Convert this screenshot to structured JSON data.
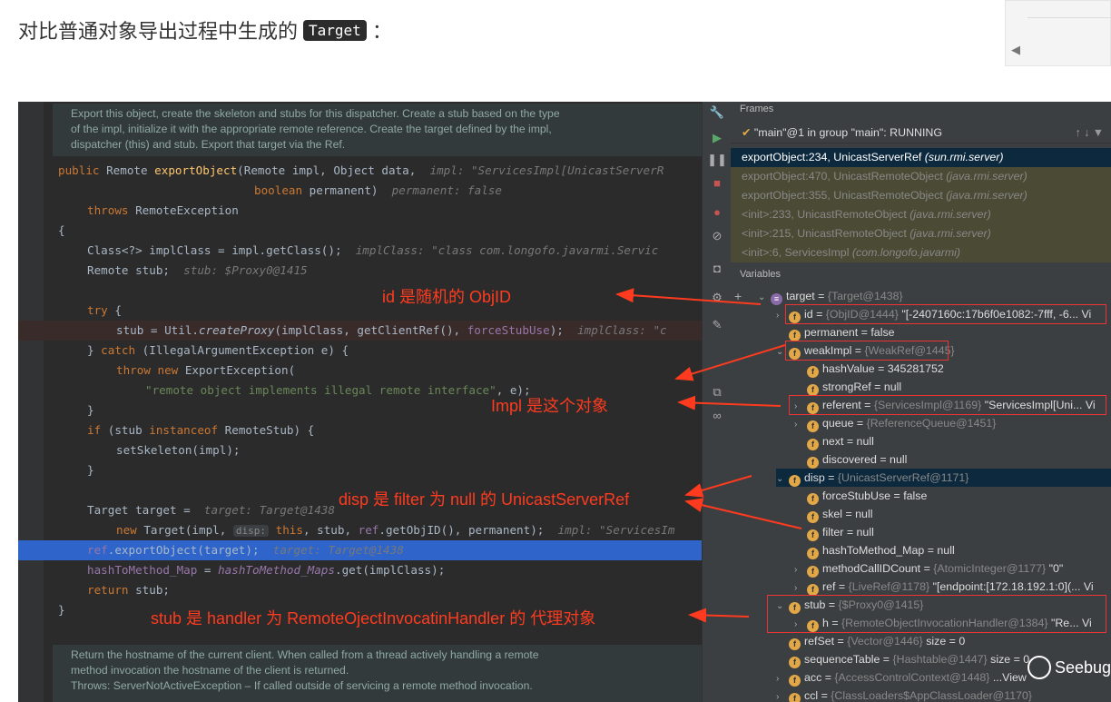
{
  "heading": {
    "prefix": "对比普通对象导出过程中生成的",
    "code": "Target",
    "suffix": "："
  },
  "editor": {
    "doc_top": [
      "Export this object, create the skeleton and stubs for this dispatcher. Create a stub based on the type",
      "of the impl, initialize it with the appropriate remote reference. Create the target defined by the impl,",
      "dispatcher (this) and stub. Export that target via the Ref."
    ],
    "doc_bottom": [
      "Return the hostname of the current client. When called from a thread actively handling a remote",
      "method invocation the hostname of the client is returned.",
      "Throws: ServerNotActiveException – If called outside of servicing a remote method invocation."
    ],
    "hint_disp": "disp:"
  },
  "debug": {
    "frames_title": "Frames",
    "thread": "\"main\"@1 in group \"main\": RUNNING",
    "frames": [
      {
        "method": "exportObject:234, UnicastServerRef",
        "pkg": "(sun.rmi.server)"
      },
      {
        "method": "exportObject:470, UnicastRemoteObject",
        "pkg": "(java.rmi.server)"
      },
      {
        "method": "exportObject:355, UnicastRemoteObject",
        "pkg": "(java.rmi.server)"
      },
      {
        "method": "<init>:233, UnicastRemoteObject",
        "pkg": "(java.rmi.server)"
      },
      {
        "method": "<init>:215, UnicastRemoteObject",
        "pkg": "(java.rmi.server)"
      },
      {
        "method": "<init>:6, ServicesImpl",
        "pkg": "(com.longofo.javarmi)"
      }
    ],
    "variables_title": "Variables",
    "vars": [
      {
        "name": "target",
        "val": "{Target@1438}",
        "extra": ""
      },
      {
        "name": "id",
        "val": "{ObjID@1444}",
        "extra": "\"[-2407160c:17b6f0e1082:-7fff, -6... Vi"
      },
      {
        "name": "permanent",
        "val": "",
        "extra": "false"
      },
      {
        "name": "weakImpl",
        "val": "{WeakRef@1445}",
        "extra": ""
      },
      {
        "name": "hashValue",
        "val": "",
        "extra": "345281752"
      },
      {
        "name": "strongRef",
        "val": "",
        "extra": "null"
      },
      {
        "name": "referent",
        "val": "{ServicesImpl@1169}",
        "extra": "\"ServicesImpl[Uni... Vi"
      },
      {
        "name": "queue",
        "val": "{ReferenceQueue@1451}",
        "extra": ""
      },
      {
        "name": "next",
        "val": "",
        "extra": "null"
      },
      {
        "name": "discovered",
        "val": "",
        "extra": "null"
      },
      {
        "name": "disp",
        "val": "{UnicastServerRef@1171}",
        "extra": ""
      },
      {
        "name": "forceStubUse",
        "val": "",
        "extra": "false"
      },
      {
        "name": "skel",
        "val": "",
        "extra": "null"
      },
      {
        "name": "filter",
        "val": "",
        "extra": "null"
      },
      {
        "name": "hashToMethod_Map",
        "val": "",
        "extra": "null"
      },
      {
        "name": "methodCallIDCount",
        "val": "{AtomicInteger@1177}",
        "extra": "\"0\""
      },
      {
        "name": "ref",
        "val": "{LiveRef@1178}",
        "extra": "\"[endpoint:[172.18.192.1:0](... Vi"
      },
      {
        "name": "stub",
        "val": "{$Proxy0@1415}",
        "extra": ""
      },
      {
        "name": "h",
        "val": "{RemoteObjectInvocationHandler@1384}",
        "extra": "\"Re... Vi"
      },
      {
        "name": "refSet",
        "val": "{Vector@1446}",
        "extra": "size = 0"
      },
      {
        "name": "sequenceTable",
        "val": "{Hashtable@1447}",
        "extra": "size = 0"
      },
      {
        "name": "acc",
        "val": "{AccessControlContext@1448}",
        "extra": "...View"
      },
      {
        "name": "ccl",
        "val": "{ClassLoaders$AppClassLoader@1170}",
        "extra": ""
      }
    ]
  },
  "annotations": {
    "a1": "id 是随机的 ObjID",
    "a2": "Impl 是这个对象",
    "a3": "disp 是 filter 为 null 的 UnicastServerRef",
    "a4": "stub 是 handler 为 RemoteOjectInvocatinHandler 的 代理对象"
  },
  "watermark": "Seebug",
  "colors": {
    "annotation": "#ff3b1f",
    "selection": "#2f65ca"
  }
}
